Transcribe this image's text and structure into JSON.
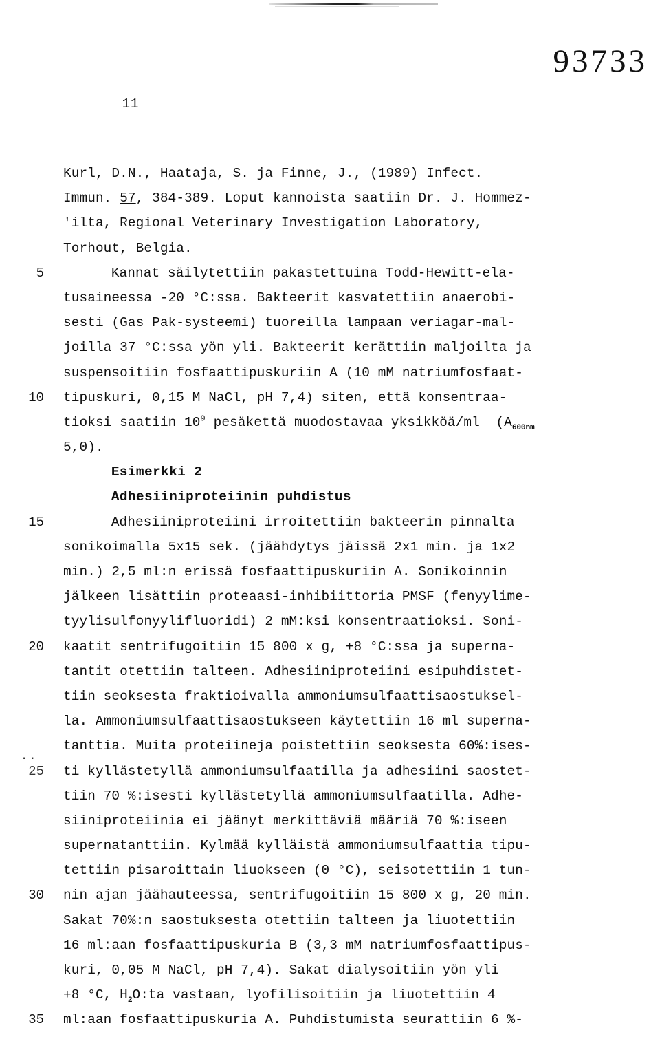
{
  "document": {
    "stamp_number": "93733",
    "page_number": "11"
  },
  "line_numbers": {
    "n5": "5",
    "n10": "10",
    "n15": "15",
    "n20": "20",
    "n25": "25",
    "n30": "30",
    "n35": "35"
  },
  "margin_marks": {
    "dots": ".."
  },
  "headings": {
    "example": "Esimerkki 2",
    "section": "Adhesiiniproteiinin puhdistus"
  },
  "body_lines": {
    "l01": "Kurl, D.N., Haataja, S. ja Finne, J., (1989) Infect.",
    "l02_a": "Immun. ",
    "l02_b": "57",
    "l02_c": ", 384-389. Loput kannoista saatiin Dr. J. Hommez-",
    "l03": "'ilta, Regional Veterinary Investigation Laboratory,",
    "l04": "Torhout, Belgia.",
    "l05": "Kannat säilytettiin pakastettuina Todd-Hewitt-ela-",
    "l06": "tusaineessa -20 °C:ssa. Bakteerit kasvatettiin anaerobi-",
    "l07": "sesti (Gas Pak-systeemi) tuoreilla lampaan veriagar-mal-",
    "l08": "joilla 37 °C:ssa yön yli. Bakteerit kerättiin maljoilta ja",
    "l09": "suspensoitiin fosfaattipuskuriin A (10 mM natriumfosfaat-",
    "l10": "tipuskuri, 0,15 M NaCl, pH 7,4) siten, että konsentraa-",
    "l11_a": "tioksi saatiin 10",
    "l11_sup": "9",
    "l11_b": " pesäkettä muodostavaa yksikköä/ml  (A",
    "l11_sub": "600nm",
    "l12": "5,0).",
    "l13": "Adhesiiniproteiini irroitettiin bakteerin pinnalta",
    "l14": "sonikoimalla 5x15 sek. (jäähdytys jäissä 2x1 min. ja 1x2",
    "l15": "min.) 2,5 ml:n erissä fosfaattipuskuriin A. Sonikoinnin",
    "l16": "jälkeen lisättiin proteaasi-inhibiittoria PMSF (fenyylime-",
    "l17": "tyylisulfonyylifluoridi) 2 mM:ksi konsentraatioksi. Soni-",
    "l18": "kaatit sentrifugoitiin 15 800 x g, +8 °C:ssa ja superna-",
    "l19": "tantit otettiin talteen. Adhesiiniproteiini esipuhdistet-",
    "l20": "tiin seoksesta fraktioivalla ammoniumsulfaattisaostuksel-",
    "l21": "la. Ammoniumsulfaattisaostukseen käytettiin 16 ml superna-",
    "l22": "tanttia. Muita proteiineja poistettiin seoksesta 60%:ises-",
    "l23": "ti kyllästetyllä ammoniumsulfaatilla ja adhesiini saostet-",
    "l24": "tiin 70 %:isesti kyllästetyllä ammoniumsulfaatilla. Adhe-",
    "l25": "siiniproteiinia ei jäänyt merkittäviä määriä 70 %:iseen",
    "l26": "supernatanttiin. Kylmää kylläistä ammoniumsulfaattia tipu-",
    "l27": "tettiin pisaroittain liuokseen (0 °C), seisotettiin 1 tun-",
    "l28": "nin ajan jäähauteessa, sentrifugoitiin 15 800 x g, 20 min.",
    "l29": "Sakat 70%:n saostuksesta otettiin talteen ja liuotettiin",
    "l30": "16 ml:aan fosfaattipuskuria B (3,3 mM natriumfosfaattipus-",
    "l31": "kuri, 0,05 M NaCl, pH 7,4). Sakat dialysoitiin yön yli",
    "l32_a": "+8 °C, H",
    "l32_sub": "2",
    "l32_b": "O:ta vastaan, lyofilisoitiin ja liuotettiin 4",
    "l33": "ml:aan fosfaattipuskuria A. Puhdistumista seurattiin 6 %-"
  }
}
